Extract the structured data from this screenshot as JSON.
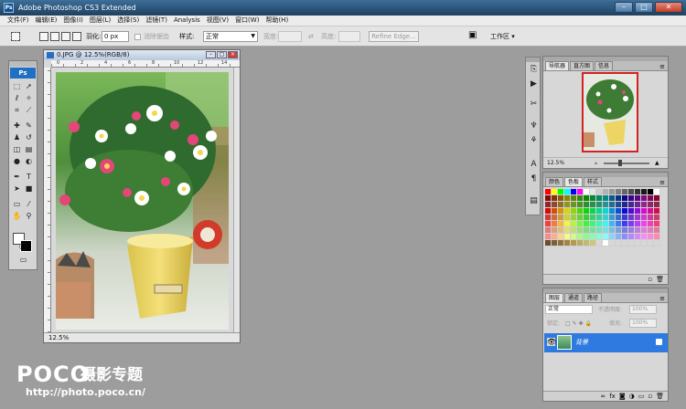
{
  "app": {
    "title": "Adobe Photoshop CS3 Extended",
    "logo": "Ps"
  },
  "window_buttons": [
    "–",
    "□",
    "✕"
  ],
  "menu": [
    "文件(F)",
    "编辑(E)",
    "图像(I)",
    "图层(L)",
    "选择(S)",
    "滤镜(T)",
    "Analysis",
    "视图(V)",
    "窗口(W)",
    "帮助(H)"
  ],
  "options": {
    "feather_label": "羽化:",
    "feather_value": "0 px",
    "antialias_label": "消除锯齿",
    "style_label": "样式:",
    "style_value": "正常",
    "width_label": "宽度:",
    "height_label": "高度:",
    "refine_edge": "Refine Edge...",
    "workspace": "工作区 ▾"
  },
  "toolbox": {
    "logo": "Ps",
    "tools": [
      "rect-marquee",
      "move",
      "lasso",
      "magic-wand",
      "crop",
      "slice",
      "healing",
      "brush",
      "stamp",
      "history-brush",
      "eraser",
      "gradient",
      "blur",
      "dodge",
      "pen",
      "type",
      "path-select",
      "shape",
      "notes",
      "eyedropper",
      "hand",
      "zoom"
    ]
  },
  "document": {
    "title": "0.JPG @ 12.5%(RGB/8)",
    "zoom": "12.5%",
    "ruler_marks": [
      "0",
      "2",
      "4",
      "6",
      "8",
      "10",
      "12",
      "14"
    ]
  },
  "panels": {
    "navigator": {
      "tabs": [
        "导航器",
        "直方图",
        "信息"
      ],
      "zoom": "12.5%"
    },
    "swatches": {
      "tabs": [
        "颜色",
        "色板",
        "样式"
      ]
    },
    "layers": {
      "tabs": [
        "图层",
        "通道",
        "路径"
      ],
      "blend_mode": "正常",
      "opacity_label": "不透明度:",
      "opacity_value": "100%",
      "lock_label": "锁定:",
      "fill_label": "填充:",
      "fill_value": "100%",
      "layer_name": "背景"
    }
  },
  "colors": {
    "titlebar": "#2a5277",
    "layer_selected": "#2f7ae0",
    "workspace_bg": "#9d9d9d"
  },
  "watermark": {
    "brand": "POCO",
    "title": "摄影专题",
    "url": "http://photo.poco.cn/"
  }
}
